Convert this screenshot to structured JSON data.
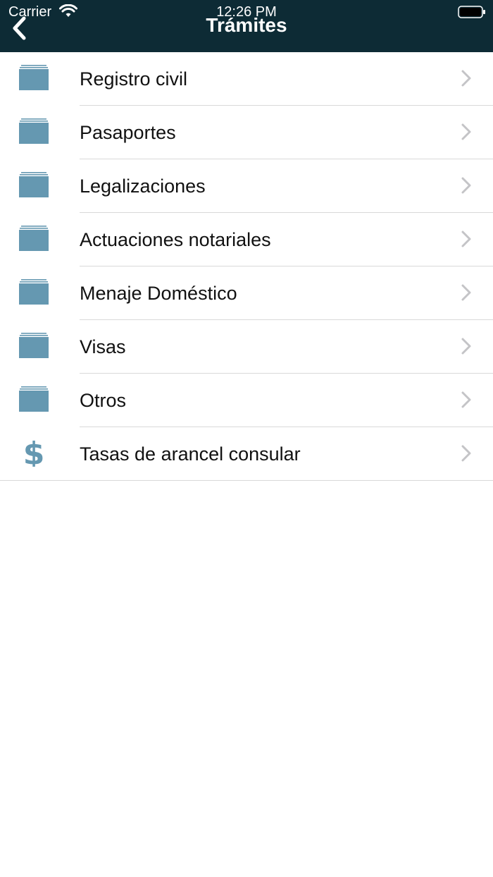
{
  "status_bar": {
    "carrier": "Carrier",
    "time": "12:26 PM"
  },
  "header": {
    "title": "Trámites"
  },
  "list": {
    "items": [
      {
        "label": "Registro civil",
        "icon": "folder-icon"
      },
      {
        "label": "Pasaportes",
        "icon": "folder-icon"
      },
      {
        "label": "Legalizaciones",
        "icon": "folder-icon"
      },
      {
        "label": "Actuaciones notariales",
        "icon": "folder-icon"
      },
      {
        "label": "Menaje Doméstico",
        "icon": "folder-icon"
      },
      {
        "label": "Visas",
        "icon": "folder-icon"
      },
      {
        "label": "Otros",
        "icon": "folder-icon"
      },
      {
        "label": "Tasas de arancel consular",
        "icon": "dollar-icon"
      }
    ]
  },
  "colors": {
    "header_bg": "#0d2b35",
    "icon": "#6598b1",
    "chevron": "#c4c4c7"
  }
}
